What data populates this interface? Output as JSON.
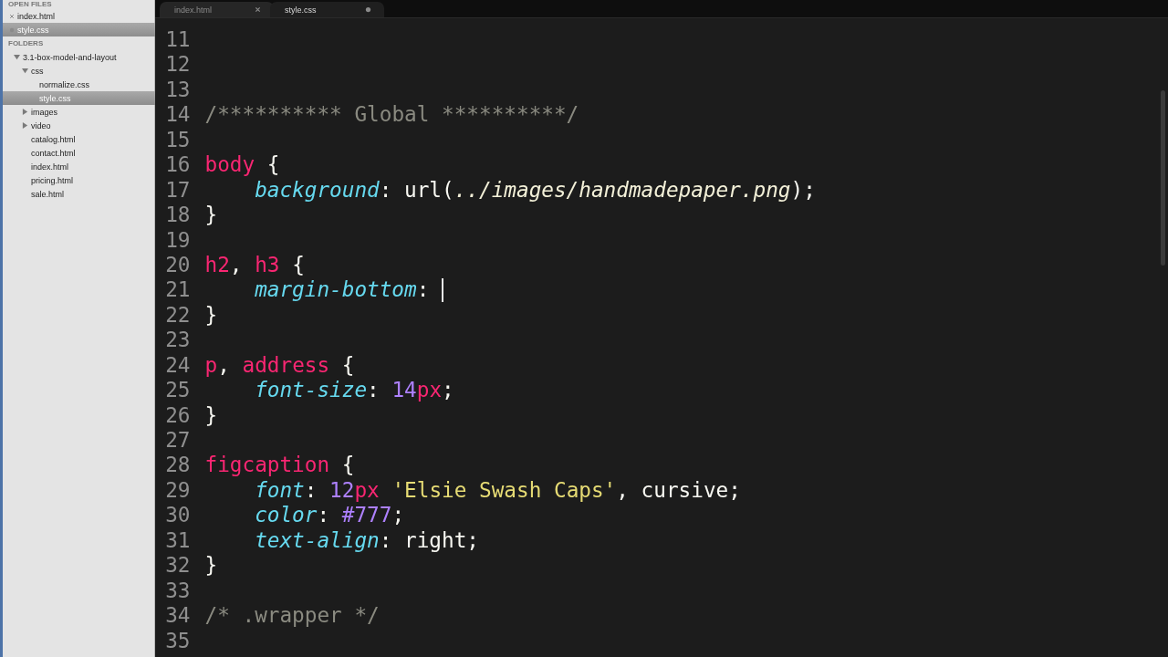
{
  "sidebar": {
    "open_files_heading": "OPEN FILES",
    "open_files": [
      {
        "label": "index.html",
        "selected": false,
        "modified": false
      },
      {
        "label": "style.css",
        "selected": true,
        "modified": true
      }
    ],
    "folders_heading": "FOLDERS",
    "tree": [
      {
        "label": "3.1-box-model-and-layout",
        "expanded": true,
        "selected": false,
        "children": [
          {
            "label": "css",
            "expanded": true,
            "selected": false,
            "children": [
              {
                "label": "normalize.css",
                "selected": false
              },
              {
                "label": "style.css",
                "selected": true
              }
            ]
          },
          {
            "label": "images",
            "expanded": false,
            "selected": false
          },
          {
            "label": "video",
            "expanded": false,
            "selected": false
          },
          {
            "label": "catalog.html",
            "selected": false
          },
          {
            "label": "contact.html",
            "selected": false
          },
          {
            "label": "index.html",
            "selected": false
          },
          {
            "label": "pricing.html",
            "selected": false
          },
          {
            "label": "sale.html",
            "selected": false
          }
        ]
      }
    ]
  },
  "tabs": [
    {
      "label": "index.html",
      "selected": false,
      "modified": false
    },
    {
      "label": "style.css",
      "selected": true,
      "modified": true
    }
  ],
  "editor": {
    "lines": [
      {
        "number": "11"
      },
      {
        "number": "12"
      },
      {
        "number": "13"
      },
      {
        "number": "14",
        "indented": false,
        "tokens": [
          {
            "kind": "comment",
            "text": "/********** Global **********/"
          }
        ]
      },
      {
        "number": "15"
      },
      {
        "number": "16",
        "indented": false,
        "tokens": [
          {
            "kind": "tag",
            "text": "body"
          },
          {
            "kind": "plain",
            "text": " {"
          }
        ]
      },
      {
        "number": "17",
        "indented": true,
        "tokens": [
          {
            "kind": "property",
            "text": "background"
          },
          {
            "kind": "plain",
            "text": ": url("
          },
          {
            "kind": "path",
            "text": "../images/handmadepaper.png"
          },
          {
            "kind": "plain",
            "text": ");"
          }
        ]
      },
      {
        "number": "18",
        "indented": false,
        "tokens": [
          {
            "kind": "plain",
            "text": "}"
          }
        ]
      },
      {
        "number": "19"
      },
      {
        "number": "20",
        "indented": false,
        "tokens": [
          {
            "kind": "tag",
            "text": "h2"
          },
          {
            "kind": "plain",
            "text": ", "
          },
          {
            "kind": "tag",
            "text": "h3"
          },
          {
            "kind": "plain",
            "text": " {"
          }
        ]
      },
      {
        "number": "21",
        "indented": true,
        "tokens": [
          {
            "kind": "property",
            "text": "margin-bottom"
          },
          {
            "kind": "plain",
            "text": ": "
          },
          {
            "kind": "caret"
          }
        ]
      },
      {
        "number": "22",
        "indented": false,
        "tokens": [
          {
            "kind": "plain",
            "text": "}"
          }
        ]
      },
      {
        "number": "23"
      },
      {
        "number": "24",
        "indented": false,
        "tokens": [
          {
            "kind": "tag",
            "text": "p"
          },
          {
            "kind": "plain",
            "text": ", "
          },
          {
            "kind": "tag",
            "text": "address"
          },
          {
            "kind": "plain",
            "text": " {"
          }
        ]
      },
      {
        "number": "25",
        "indented": true,
        "tokens": [
          {
            "kind": "property",
            "text": "font-size"
          },
          {
            "kind": "plain",
            "text": ": "
          },
          {
            "kind": "number",
            "text": "14"
          },
          {
            "kind": "unit",
            "text": "px"
          },
          {
            "kind": "plain",
            "text": ";"
          }
        ]
      },
      {
        "number": "26",
        "indented": false,
        "tokens": [
          {
            "kind": "plain",
            "text": "}"
          }
        ]
      },
      {
        "number": "27"
      },
      {
        "number": "28",
        "indented": false,
        "tokens": [
          {
            "kind": "tag",
            "text": "figcaption"
          },
          {
            "kind": "plain",
            "text": " {"
          }
        ]
      },
      {
        "number": "29",
        "indented": true,
        "tokens": [
          {
            "kind": "property",
            "text": "font"
          },
          {
            "kind": "plain",
            "text": ": "
          },
          {
            "kind": "number",
            "text": "12"
          },
          {
            "kind": "unit",
            "text": "px "
          },
          {
            "kind": "string",
            "text": "'Elsie Swash Caps'"
          },
          {
            "kind": "plain",
            "text": ", cursive;"
          }
        ]
      },
      {
        "number": "30",
        "indented": true,
        "tokens": [
          {
            "kind": "property",
            "text": "color"
          },
          {
            "kind": "plain",
            "text": ": "
          },
          {
            "kind": "number",
            "text": "#777"
          },
          {
            "kind": "plain",
            "text": ";"
          }
        ]
      },
      {
        "number": "31",
        "indented": true,
        "tokens": [
          {
            "kind": "property",
            "text": "text-align"
          },
          {
            "kind": "plain",
            "text": ": right;"
          }
        ]
      },
      {
        "number": "32",
        "indented": false,
        "tokens": [
          {
            "kind": "plain",
            "text": "}"
          }
        ]
      },
      {
        "number": "33"
      },
      {
        "number": "34",
        "indented": false,
        "tokens": [
          {
            "kind": "comment",
            "text": "/* .wrapper */"
          }
        ]
      },
      {
        "number": "35"
      }
    ]
  }
}
